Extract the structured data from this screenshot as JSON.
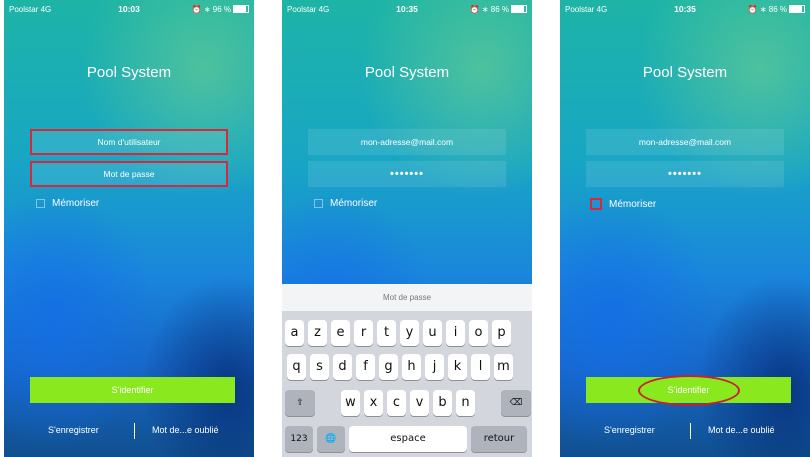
{
  "app_title": "Pool System",
  "remember_label": "Mémoriser",
  "login_button": "S'identifier",
  "register_link": "S'enregistrer",
  "forgot_link": "Mot de...e oublié",
  "screens": [
    {
      "status": {
        "carrier": "Poolstar 4G",
        "time": "10:03",
        "battery": "96 %"
      },
      "username_field": "Nom d'utilisateur",
      "password_field": "Mot de passe"
    },
    {
      "status": {
        "carrier": "Poolstar 4G",
        "time": "10:35",
        "battery": "86 %"
      },
      "username_field": "mon-adresse@mail.com",
      "password_field": "•••••••"
    },
    {
      "status": {
        "carrier": "Poolstar 4G",
        "time": "10:35",
        "battery": "86 %"
      },
      "username_field": "mon-adresse@mail.com",
      "password_field": "•••••••"
    }
  ],
  "keyboard": {
    "header": "Mot de passe",
    "row1": [
      "a",
      "z",
      "e",
      "r",
      "t",
      "y",
      "u",
      "i",
      "o",
      "p"
    ],
    "row2": [
      "q",
      "s",
      "d",
      "f",
      "g",
      "h",
      "j",
      "k",
      "l",
      "m"
    ],
    "row3": [
      "w",
      "x",
      "c",
      "v",
      "b",
      "n"
    ],
    "numbers_key": "123",
    "space_key": "espace",
    "return_key": "retour"
  },
  "icons": {
    "shift": "⇧",
    "delete": "⌫",
    "globe": "🌐",
    "alarm_bluetooth": "⏰ ∗"
  },
  "colors": {
    "accent_green": "#8ae81f",
    "highlight_red": "#d9273c"
  }
}
